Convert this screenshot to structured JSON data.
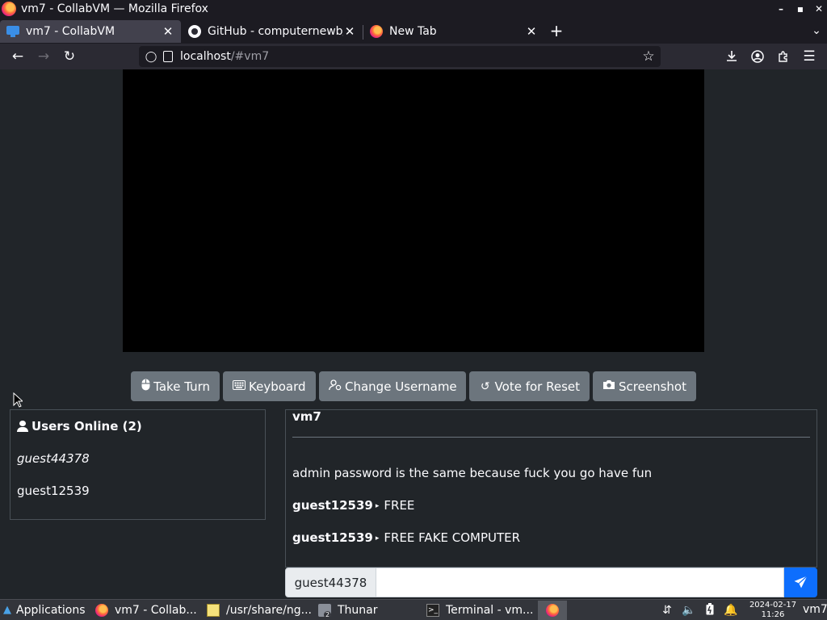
{
  "window": {
    "title": "vm7 - CollabVM — Mozilla Firefox"
  },
  "tabs": [
    {
      "label": "vm7 - CollabVM",
      "active": true
    },
    {
      "label": "GitHub - computernewb/",
      "active": false
    },
    {
      "label": "New Tab",
      "active": false
    }
  ],
  "urlbar": {
    "host": "localhost",
    "path": "/#vm7"
  },
  "vm": {
    "buttons": {
      "take_turn": "Take Turn",
      "keyboard": "Keyboard",
      "change_username": "Change Username",
      "vote_reset": "Vote for Reset",
      "screenshot": "Screenshot"
    }
  },
  "users": {
    "title": "Users Online (2)",
    "list": [
      "guest44378",
      "guest12539"
    ]
  },
  "chat": {
    "room": "vm7",
    "messages": [
      {
        "sender": "",
        "text": "admin password is the same because fuck you go have fun"
      },
      {
        "sender": "guest12539",
        "text": "FREE"
      },
      {
        "sender": "guest12539",
        "text": "FREE FAKE COMPUTER"
      }
    ],
    "username": "guest44378",
    "input_value": ""
  },
  "taskbar": {
    "apps_label": "Applications",
    "tasks": [
      {
        "label": "vm7 - Collab...",
        "icon": "firefox-icon",
        "active": false
      },
      {
        "label": "/usr/share/ng...",
        "icon": "text-editor-icon",
        "active": false
      },
      {
        "label": "Thunar",
        "icon": "folder-icon",
        "active": false
      },
      {
        "label": "Terminal - vm...",
        "icon": "terminal-icon",
        "active": false
      }
    ],
    "thunar_count": "2",
    "date": "2024-02-17",
    "time": "11:26",
    "workspace": "vm7"
  },
  "colors": {
    "accent": "#0d6efd",
    "button": "#6c757d",
    "page_bg": "#212529",
    "chrome_bg": "#1c1b22"
  }
}
